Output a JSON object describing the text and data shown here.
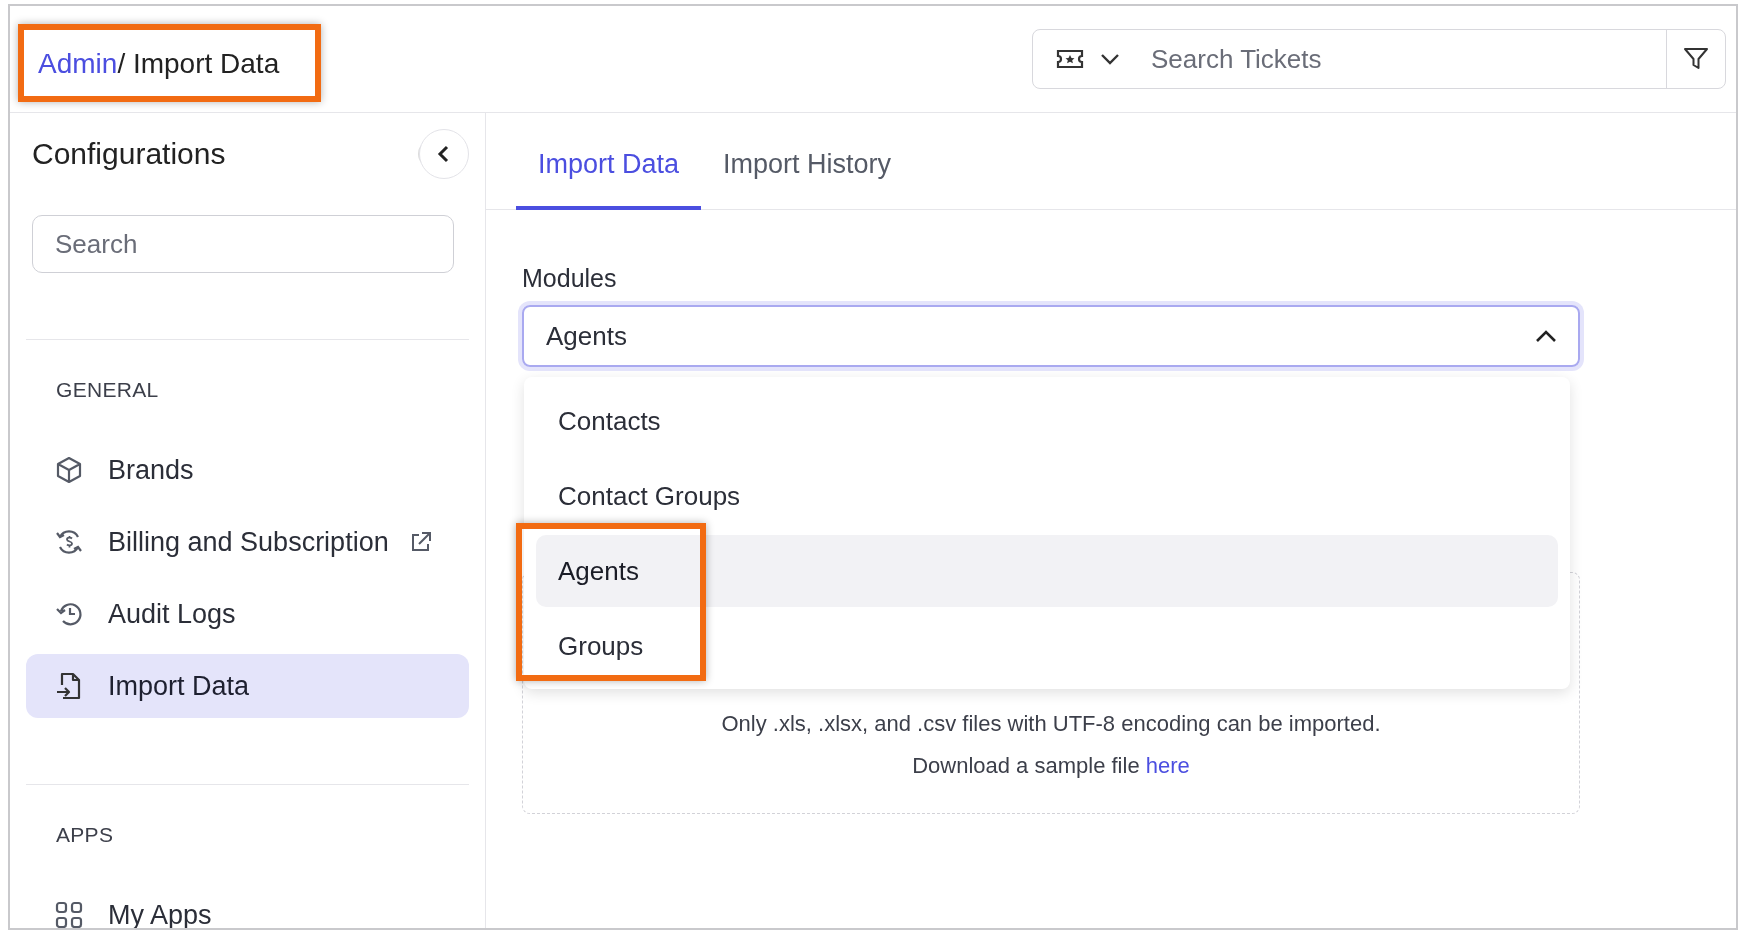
{
  "breadcrumb": {
    "link": "Admin",
    "current": "/ Import Data"
  },
  "top_search": {
    "placeholder": "Search Tickets"
  },
  "sidebar": {
    "title": "Configurations",
    "search": {
      "placeholder": "Search"
    },
    "sections": [
      {
        "heading": "GENERAL",
        "items": [
          {
            "label": "Brands",
            "external": false,
            "selected": false
          },
          {
            "label": "Billing and Subscription",
            "external": true,
            "selected": false
          },
          {
            "label": "Audit Logs",
            "external": false,
            "selected": false
          },
          {
            "label": "Import Data",
            "external": false,
            "selected": true
          }
        ]
      },
      {
        "heading": "APPS",
        "items": [
          {
            "label": "My Apps",
            "external": false,
            "selected": false
          }
        ]
      }
    ]
  },
  "tabs": [
    {
      "label": "Import Data",
      "selected": true
    },
    {
      "label": "Import History",
      "selected": false
    }
  ],
  "modules": {
    "label": "Modules",
    "value": "Agents",
    "expanded": true,
    "options": [
      {
        "label": "Contacts",
        "selected": false
      },
      {
        "label": "Contact Groups",
        "selected": false
      },
      {
        "label": "Agents",
        "selected": true
      },
      {
        "label": "Groups",
        "selected": false
      }
    ]
  },
  "upload": {
    "note": "Only .xls, .xlsx, and .csv files with UTF-8 encoding can be imported.",
    "sample_text": "Download a sample file",
    "sample_link": "here"
  }
}
